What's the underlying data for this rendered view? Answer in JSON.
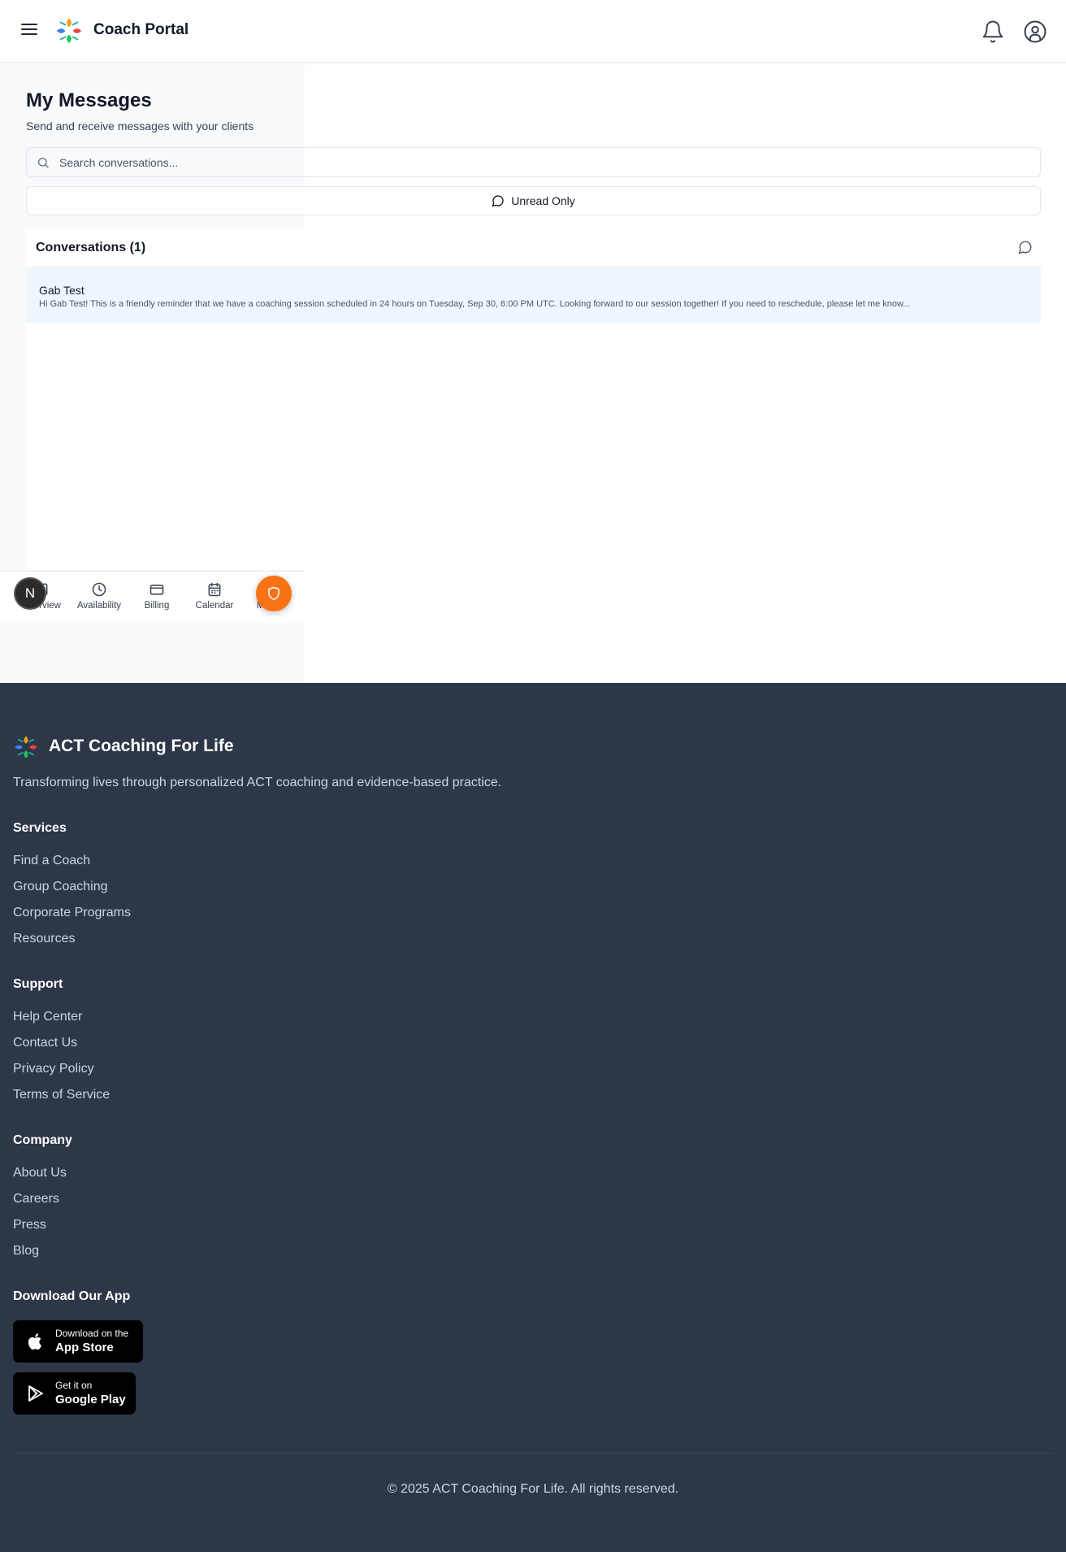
{
  "header": {
    "brand": "Coach Portal"
  },
  "page": {
    "title": "My Messages",
    "subtitle": "Send and receive messages with your clients"
  },
  "search": {
    "placeholder": "Search conversations..."
  },
  "filter": {
    "unread_label": "Unread Only"
  },
  "conversations": {
    "title": "Conversations (1)",
    "items": [
      {
        "name": "Gab Test",
        "preview": "Hi Gab Test! This is a friendly reminder that we have a coaching session scheduled in 24 hours on Tuesday, Sep 30, 6:00 PM UTC. Looking forward to our session together! If you need to reschedule, please let me know..."
      }
    ]
  },
  "bottom_nav": {
    "items": [
      {
        "label": "Overview"
      },
      {
        "label": "Availability"
      },
      {
        "label": "Billing"
      },
      {
        "label": "Calendar"
      },
      {
        "label": "More"
      }
    ],
    "avatar_initial": "N"
  },
  "footer": {
    "brand": "ACT Coaching For Life",
    "tagline": "Transforming lives through personalized ACT coaching and evidence-based practice.",
    "sections": [
      {
        "title": "Services",
        "links": [
          "Find a Coach",
          "Group Coaching",
          "Corporate Programs",
          "Resources"
        ]
      },
      {
        "title": "Support",
        "links": [
          "Help Center",
          "Contact Us",
          "Privacy Policy",
          "Terms of Service"
        ]
      },
      {
        "title": "Company",
        "links": [
          "About Us",
          "Careers",
          "Press",
          "Blog"
        ]
      }
    ],
    "app": {
      "title": "Download Our App",
      "app_store_small": "Download on the",
      "app_store_big": "App Store",
      "google_small": "Get it on",
      "google_big": "Google Play"
    },
    "copyright": "© 2025 ACT Coaching For Life. All rights reserved."
  },
  "colors": {
    "accent": "#f97316",
    "footer_bg": "#2d3748",
    "selected_row": "#eff6ff"
  },
  "icons": [
    "menu-icon",
    "logo-icon",
    "bell-icon",
    "user-circle-icon",
    "search-icon",
    "message-circle-icon",
    "clock-icon",
    "credit-card-icon",
    "calendar-icon",
    "shield-icon",
    "apple-icon",
    "play-store-icon"
  ]
}
